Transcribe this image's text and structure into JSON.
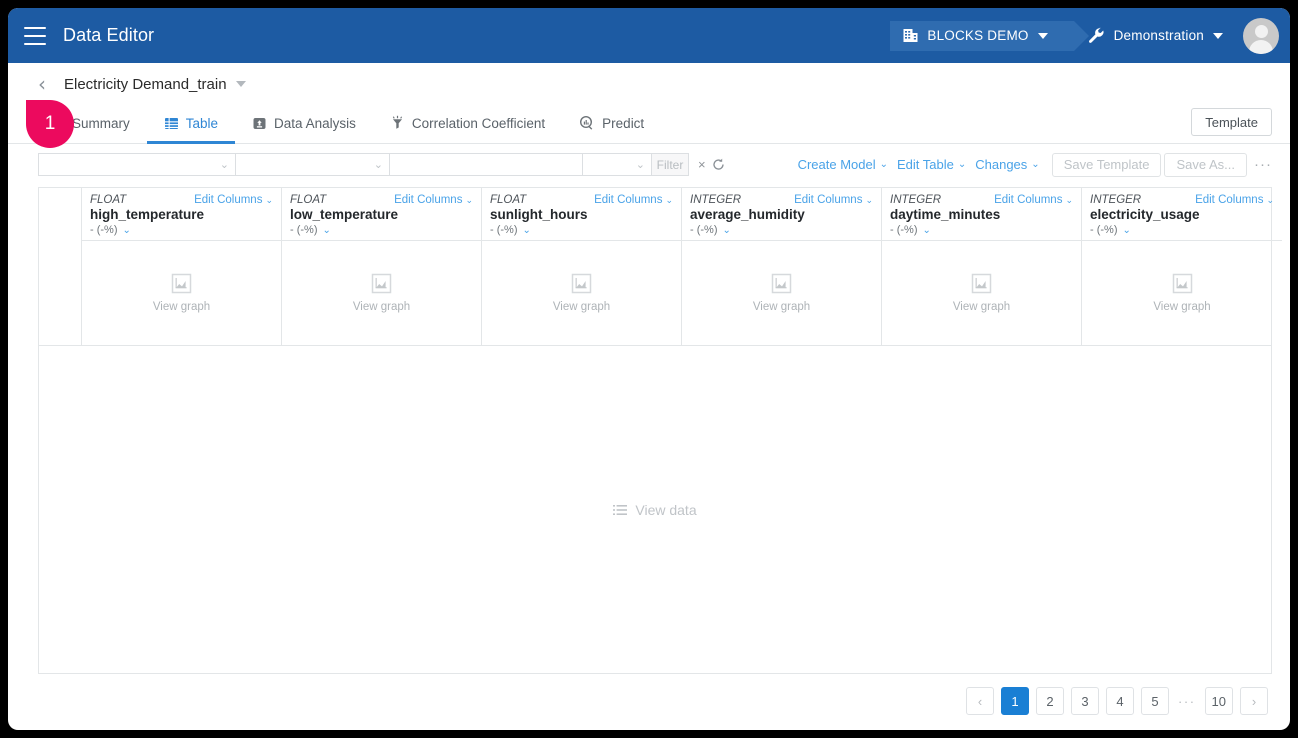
{
  "appbar": {
    "menu_icon": "hamburger-icon",
    "title": "Data Editor",
    "workspace_chip": {
      "icon": "building-icon",
      "label": "BLOCKS DEMO"
    },
    "project_chip": {
      "icon": "wrench-icon",
      "label": "Demonstration"
    },
    "avatar": "user-avatar"
  },
  "breadcrumb": {
    "back_icon": "chevron-left-icon",
    "title": "Electricity Demand_train"
  },
  "marker": {
    "label": "1"
  },
  "tabs": [
    {
      "label": "Summary",
      "icon": "summary-icon",
      "active": false
    },
    {
      "label": "Table",
      "icon": "table-icon",
      "active": true
    },
    {
      "label": "Data Analysis",
      "icon": "analysis-icon",
      "active": false
    },
    {
      "label": "Correlation Coefficient",
      "icon": "correlation-icon",
      "active": false
    },
    {
      "label": "Predict",
      "icon": "predict-icon",
      "active": false
    }
  ],
  "template_button": "Template",
  "toolbar": {
    "field1": {
      "value": "",
      "placeholder": ""
    },
    "field2": {
      "value": "",
      "placeholder": ""
    },
    "field3": {
      "value": "",
      "placeholder": ""
    },
    "field4": {
      "value": "",
      "placeholder": ""
    },
    "filter_button": "Filter",
    "clear_icon": "close-icon",
    "refresh_icon": "refresh-icon",
    "links": [
      {
        "label": "Create Model",
        "caret": "⌄"
      },
      {
        "label": "Edit Table",
        "caret": "⌄"
      },
      {
        "label": "Changes",
        "caret": "⌄"
      }
    ],
    "save_template_button": "Save Template",
    "save_as_button": "Save As...",
    "more_button": "···"
  },
  "table": {
    "edit_columns_label": "Edit Columns",
    "view_graph_label": "View graph",
    "view_data_label": "View data",
    "columns": [
      {
        "type": "FLOAT",
        "name": "high_temperature",
        "stat": "- (-%)"
      },
      {
        "type": "FLOAT",
        "name": "low_temperature",
        "stat": "- (-%)"
      },
      {
        "type": "FLOAT",
        "name": "sunlight_hours",
        "stat": "- (-%)"
      },
      {
        "type": "INTEGER",
        "name": "average_humidity",
        "stat": "- (-%)"
      },
      {
        "type": "INTEGER",
        "name": "daytime_minutes",
        "stat": "- (-%)"
      },
      {
        "type": "INTEGER",
        "name": "electricity_usage",
        "stat": "- (-%)"
      }
    ]
  },
  "pagination": {
    "prev": "‹",
    "next": "›",
    "ellipsis": "···",
    "pages": [
      "1",
      "2",
      "3",
      "4",
      "5"
    ],
    "last_page": "10",
    "current": "1"
  },
  "colors": {
    "header_blue": "#1d5ba3",
    "accent_blue": "#2f86d4",
    "link_blue": "#4aa3e8",
    "marker_pink": "#ec0a5e",
    "active_page": "#1a7fd4"
  }
}
